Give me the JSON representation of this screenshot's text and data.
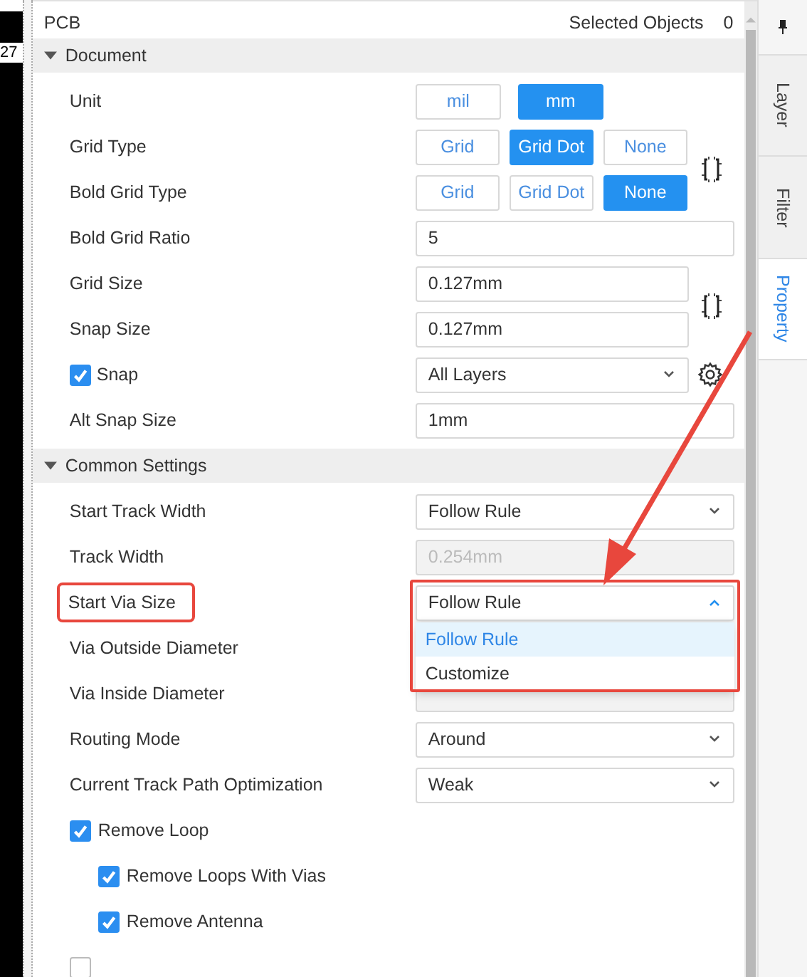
{
  "ruler_text": "27",
  "header": {
    "title": "PCB",
    "selected_label": "Selected Objects",
    "selected_count": "0"
  },
  "sections": [
    {
      "title": "Document",
      "expanded": true,
      "rows": [
        {
          "kind": "segmented",
          "label": "Unit",
          "options": [
            {
              "label": "mil",
              "selected": false
            },
            {
              "label": "mm",
              "selected": true
            }
          ]
        },
        {
          "kind": "segmented",
          "label": "Grid Type",
          "link_icon": true,
          "options": [
            {
              "label": "Grid",
              "selected": false
            },
            {
              "label": "Grid Dot",
              "selected": true
            },
            {
              "label": "None",
              "selected": false
            }
          ]
        },
        {
          "kind": "segmented",
          "label": "Bold Grid Type",
          "options": [
            {
              "label": "Grid",
              "selected": false
            },
            {
              "label": "Grid Dot",
              "selected": false
            },
            {
              "label": "None",
              "selected": true
            }
          ]
        },
        {
          "kind": "input",
          "label": "Bold Grid Ratio",
          "value": "5",
          "disabled": false
        },
        {
          "kind": "input",
          "label": "Grid Size",
          "value": "0.127mm",
          "disabled": false,
          "link_icon": true
        },
        {
          "kind": "input",
          "label": "Snap Size",
          "value": "0.127mm",
          "disabled": false,
          "narrow": true
        },
        {
          "kind": "select",
          "label": "Snap",
          "checked": true,
          "value": "All Layers",
          "open": false,
          "gear_icon": true
        },
        {
          "kind": "input",
          "label": "Alt Snap Size",
          "value": "1mm",
          "disabled": false
        }
      ]
    },
    {
      "title": "Common Settings",
      "expanded": true,
      "rows": [
        {
          "kind": "select",
          "label": "Start Track Width",
          "value": "Follow Rule",
          "open": false
        },
        {
          "kind": "input",
          "label": "Track Width",
          "value": "0.254mm",
          "disabled": true
        },
        {
          "kind": "select",
          "label": "Start Via Size",
          "value": "Follow Rule",
          "open": true,
          "highlighted": true,
          "options": [
            {
              "label": "Follow Rule",
              "selected": true
            },
            {
              "label": "Customize",
              "selected": false
            }
          ]
        },
        {
          "kind": "label",
          "label": "Via Outside Diameter"
        },
        {
          "kind": "input",
          "label": "Via Inside Diameter",
          "disabled": true
        },
        {
          "kind": "select",
          "label": "Routing Mode",
          "value": "Around",
          "open": false
        },
        {
          "kind": "select",
          "label": "Current Track Path Optimization",
          "value": "Weak",
          "open": false
        },
        {
          "kind": "checkbox",
          "label": "Remove Loop",
          "checked": true,
          "children": [
            {
              "kind": "checkbox",
              "label": "Remove Loops With Vias",
              "checked": true
            },
            {
              "kind": "checkbox",
              "label": "Remove Antenna",
              "checked": true
            }
          ]
        },
        {
          "kind": "checkbox",
          "checked": false
        }
      ]
    }
  ],
  "side_tabs": [
    {
      "label": "Layer",
      "selected": false
    },
    {
      "label": "Filter",
      "selected": false
    },
    {
      "label": "Property",
      "selected": true
    }
  ]
}
